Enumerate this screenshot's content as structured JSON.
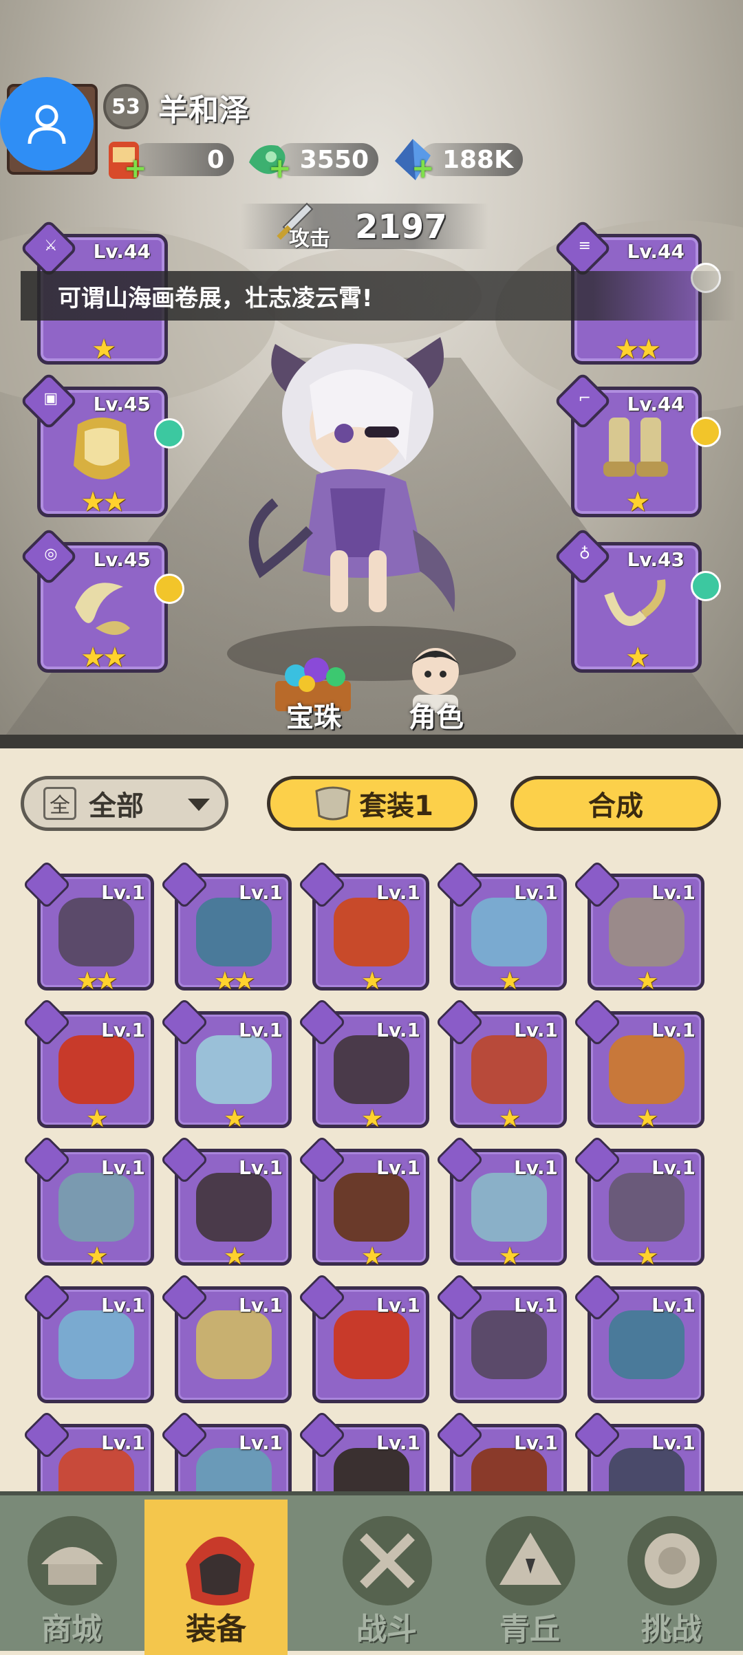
{
  "player": {
    "level": "53",
    "name": "羊和泽",
    "resources": [
      {
        "icon": "scroll-bag-icon",
        "value": "0"
      },
      {
        "icon": "jade-coin-icon",
        "value": "3550"
      },
      {
        "icon": "crystal-icon",
        "value": "188K"
      }
    ],
    "attack_label": "攻击",
    "attack_value": "2197"
  },
  "banner_text": "可谓山海画卷展，壮志凌云霄!",
  "equipped": [
    {
      "slot": "weapon",
      "level": "Lv.44",
      "stars": 1
    },
    {
      "slot": "armor",
      "level": "Lv.45",
      "stars": 2,
      "gem": "#3cc8a0"
    },
    {
      "slot": "ring",
      "level": "Lv.45",
      "stars": 2,
      "gem": "#f2c52a"
    },
    {
      "slot": "belt",
      "level": "Lv.44",
      "stars": 2,
      "gem": "#d8d4c8"
    },
    {
      "slot": "boots",
      "level": "Lv.44",
      "stars": 1,
      "gem": "#f2c52a"
    },
    {
      "slot": "amulet",
      "level": "Lv.43",
      "stars": 1,
      "gem": "#3cc8a0"
    }
  ],
  "scene_buttons": {
    "orbs": "宝珠",
    "character": "角色"
  },
  "toolbar": {
    "filter_icon": "全",
    "filter_label": "全部",
    "set_label": "套装1",
    "merge_label": "合成"
  },
  "inventory": [
    {
      "level": "Lv.1",
      "stars": 2,
      "color": "#5b4a6a"
    },
    {
      "level": "Lv.1",
      "stars": 2,
      "color": "#4a7a9a"
    },
    {
      "level": "Lv.1",
      "stars": 1,
      "color": "#c84a2a"
    },
    {
      "level": "Lv.1",
      "stars": 1,
      "color": "#7aaad0"
    },
    {
      "level": "Lv.1",
      "stars": 1,
      "color": "#9a8a8a"
    },
    {
      "level": "Lv.1",
      "stars": 1,
      "color": "#c83a2a"
    },
    {
      "level": "Lv.1",
      "stars": 1,
      "color": "#9ac0d8"
    },
    {
      "level": "Lv.1",
      "stars": 1,
      "color": "#4a3a4a"
    },
    {
      "level": "Lv.1",
      "stars": 1,
      "color": "#b84a3a"
    },
    {
      "level": "Lv.1",
      "stars": 1,
      "color": "#c8783a"
    },
    {
      "level": "Lv.1",
      "stars": 1,
      "color": "#7a9ab0"
    },
    {
      "level": "Lv.1",
      "stars": 1,
      "color": "#4a3a4a"
    },
    {
      "level": "Lv.1",
      "stars": 1,
      "color": "#6a3a2a"
    },
    {
      "level": "Lv.1",
      "stars": 1,
      "color": "#8ab0c8"
    },
    {
      "level": "Lv.1",
      "stars": 1,
      "color": "#6a5a7a"
    },
    {
      "level": "Lv.1",
      "stars": 0,
      "color": "#7aaad0"
    },
    {
      "level": "Lv.1",
      "stars": 0,
      "color": "#c8b070"
    },
    {
      "level": "Lv.1",
      "stars": 0,
      "color": "#c83a2a"
    },
    {
      "level": "Lv.1",
      "stars": 0,
      "color": "#5b4a6a"
    },
    {
      "level": "Lv.1",
      "stars": 0,
      "color": "#4a7a9a"
    },
    {
      "level": "Lv.1",
      "stars": 0,
      "color": "#c84a3a"
    },
    {
      "level": "Lv.1",
      "stars": 0,
      "color": "#6a9ab8"
    },
    {
      "level": "Lv.1",
      "stars": 0,
      "color": "#3a3030"
    },
    {
      "level": "Lv.1",
      "stars": 0,
      "color": "#8a3a2a"
    },
    {
      "level": "Lv.1",
      "stars": 0,
      "color": "#4a4a6a"
    }
  ],
  "nav": [
    {
      "label": "商城",
      "icon": "shop-icon"
    },
    {
      "label": "装备",
      "icon": "helmet-icon",
      "active": true
    },
    {
      "label": "战斗",
      "icon": "crossed-swords-icon"
    },
    {
      "label": "青丘",
      "icon": "mountain-icon"
    },
    {
      "label": "挑战",
      "icon": "orb-challenge-icon"
    }
  ]
}
